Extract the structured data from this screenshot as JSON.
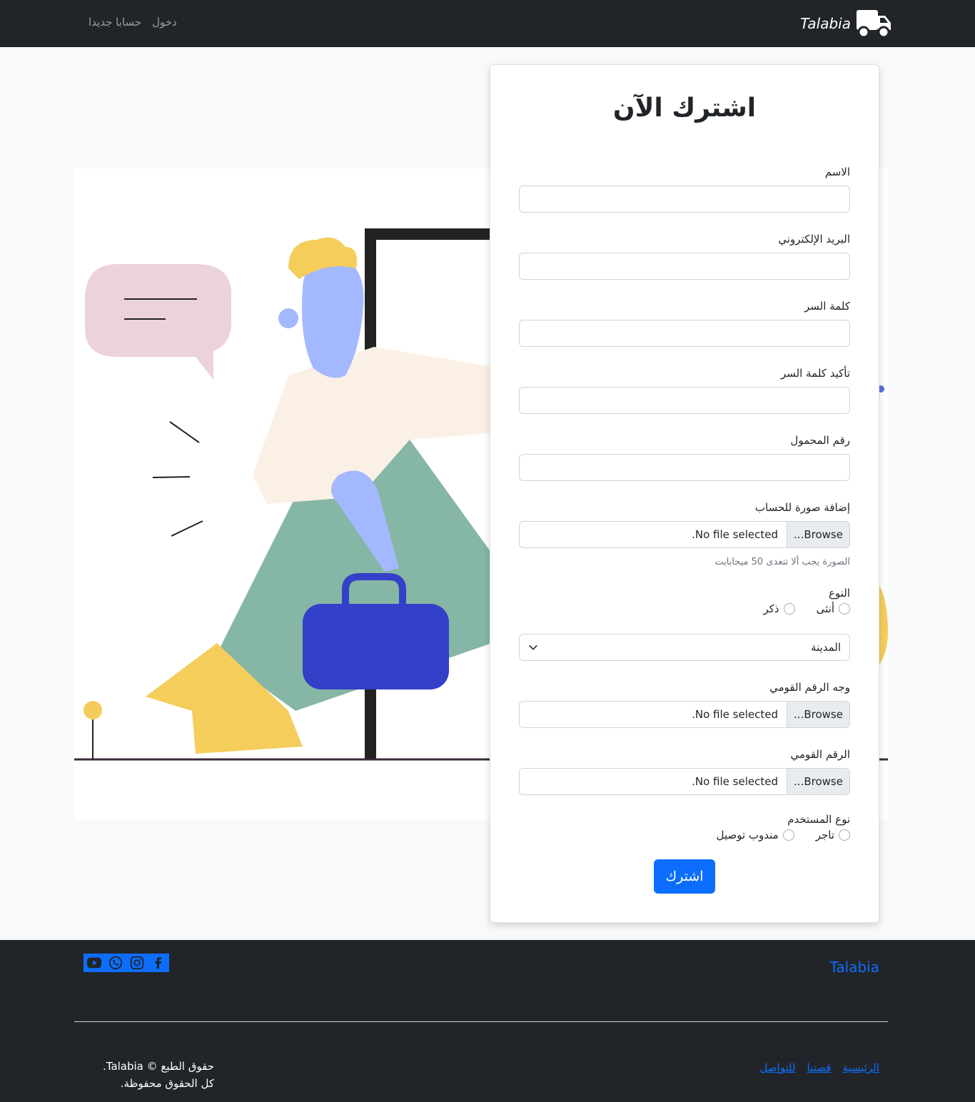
{
  "navbar": {
    "brand": "Talabia",
    "links": [
      "دخول",
      "حسابا جديدا"
    ]
  },
  "form": {
    "title": "اشترك الآن",
    "fields": {
      "name_label": "الاسم",
      "email_label": "البريد الإلكتروني",
      "password_label": "كلمة السر",
      "confirm_label": "تأكيد كلمة السر",
      "phone_label": "رقم المحمول",
      "photo_label": "إضافة صورة للحساب",
      "photo_help": "الصورة يجب ألا تتعدى 50 ميجابايت",
      "gender_label": "النوع",
      "gender_options": [
        "أنثى",
        "ذكر"
      ],
      "city_placeholder": "المدينة",
      "id_front_label": "وجه الرقم القومي",
      "id_label": "الرقم القومي",
      "user_type_label": "نوع المستخدم",
      "user_type_options": [
        "تاجر",
        "مندوب توصيل"
      ]
    },
    "file_browse": "Browse...",
    "file_empty": "No file selected.",
    "submit": "اشترك"
  },
  "footer": {
    "brand": "Talabia",
    "social_icons": [
      "facebook-icon",
      "instagram-icon",
      "whatsapp-icon",
      "youtube-icon"
    ],
    "links": [
      "الرئيسية",
      "قصتنا",
      "للتواصل"
    ],
    "copyright_line1": "حقوق الطبع © Talabia.",
    "copyright_line2": "كل الحقوق محفوظة."
  },
  "colors": {
    "primary": "#0d6efd",
    "dark": "#212529",
    "light_bg": "#f8f9fa"
  }
}
